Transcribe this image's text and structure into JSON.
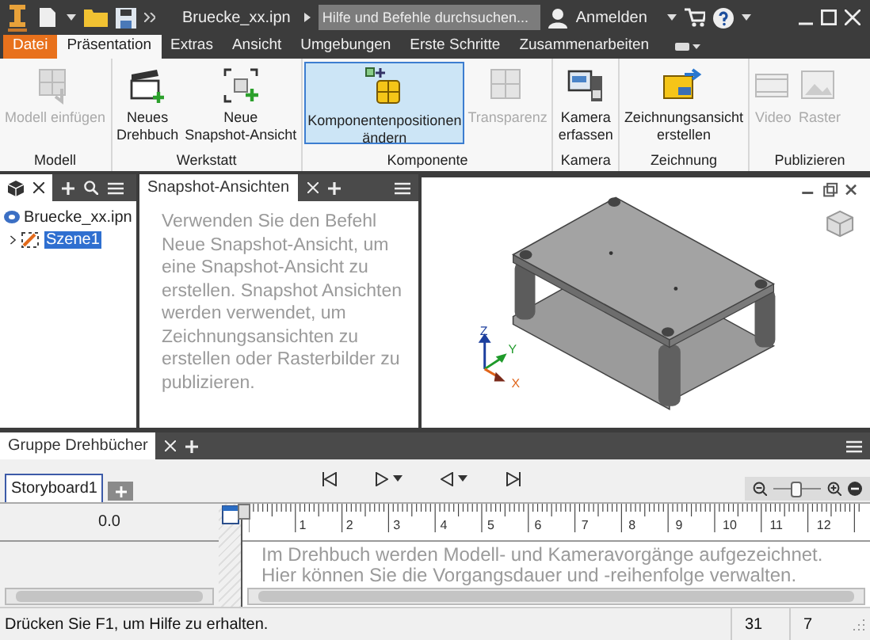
{
  "title_bar": {
    "file_name": "Bruecke_xx.ipn",
    "search": {
      "placeholder": "Hilfe und Befehle durchsuchen..."
    },
    "user": "Anmelden"
  },
  "ribbon_tabs": [
    {
      "label": "Datei",
      "kind": "file",
      "selected": false
    },
    {
      "label": "Präsentation",
      "kind": "tab",
      "selected": true
    },
    {
      "label": "Extras",
      "kind": "tab",
      "selected": false
    },
    {
      "label": "Ansicht",
      "kind": "tab",
      "selected": false
    },
    {
      "label": "Umgebungen",
      "kind": "tab",
      "selected": false
    },
    {
      "label": "Erste Schritte",
      "kind": "tab",
      "selected": false
    },
    {
      "label": "Zusammenarbeiten",
      "kind": "tab",
      "selected": false
    }
  ],
  "ribbon_groups": [
    {
      "label": "Modell",
      "buttons": [
        {
          "label": "Modell einfügen",
          "disabled": true,
          "selected": false
        }
      ]
    },
    {
      "label": "Werkstatt",
      "buttons": [
        {
          "label": "Neues\nDrehbuch",
          "disabled": false,
          "selected": false
        },
        {
          "label": "Neue\nSnapshot-Ansicht",
          "disabled": false,
          "selected": false
        }
      ]
    },
    {
      "label": "Komponente",
      "buttons": [
        {
          "label": "Komponentenpositionen\nändern",
          "disabled": false,
          "selected": true
        },
        {
          "label": "Transparenz",
          "disabled": true,
          "selected": false
        }
      ]
    },
    {
      "label": "Kamera",
      "buttons": [
        {
          "label": "Kamera\nerfassen",
          "disabled": false,
          "selected": false
        }
      ]
    },
    {
      "label": "Zeichnung",
      "buttons": [
        {
          "label": "Zeichnungsansicht\nerstellen",
          "disabled": false,
          "selected": false
        }
      ]
    },
    {
      "label": "Publizieren",
      "buttons": [
        {
          "label": "Video",
          "disabled": true,
          "selected": false
        },
        {
          "label": "Raster",
          "disabled": true,
          "selected": false
        }
      ]
    }
  ],
  "browser": {
    "tree": [
      {
        "label": "Bruecke_xx.ipn",
        "selected": false,
        "children": [
          {
            "label": "Szene1",
            "selected": true,
            "expanded": false
          }
        ]
      }
    ]
  },
  "snapshot_panel": {
    "tab": "Snapshot-Ansichten",
    "message": "Verwenden Sie den Befehl Neue Snapshot-Ansicht, um eine Snapshot-Ansicht zu erstellen. Snapshot Ansichten werden verwendet, um Zeichnungsansichten zu erstellen oder Rasterbilder zu publizieren."
  },
  "viewport": {
    "axes": [
      {
        "label": "Z",
        "color": "#1c3f9e"
      },
      {
        "label": "Y",
        "color": "#1f9a2a"
      },
      {
        "label": "X",
        "color": "#e0651a"
      }
    ]
  },
  "storyboard_panel": {
    "tab": "Gruppe Drehbücher",
    "storyboards": [
      {
        "label": "Storyboard1",
        "selected": true
      }
    ],
    "zoom": {
      "level": 0.45
    },
    "time": "0.0",
    "ruler_labels": [
      "1",
      "2",
      "3",
      "4",
      "5",
      "6",
      "7",
      "8",
      "9",
      "10",
      "11",
      "12"
    ],
    "message": [
      "Im Drehbuch werden Modell- und Kameravorgänge aufgezeichnet.",
      "Hier können Sie die Vorgangsdauer und -reihenfolge verwalten."
    ]
  },
  "status_bar": {
    "text": "Drücken Sie F1, um Hilfe zu erhalten.",
    "cells": [
      "31",
      "7"
    ]
  }
}
